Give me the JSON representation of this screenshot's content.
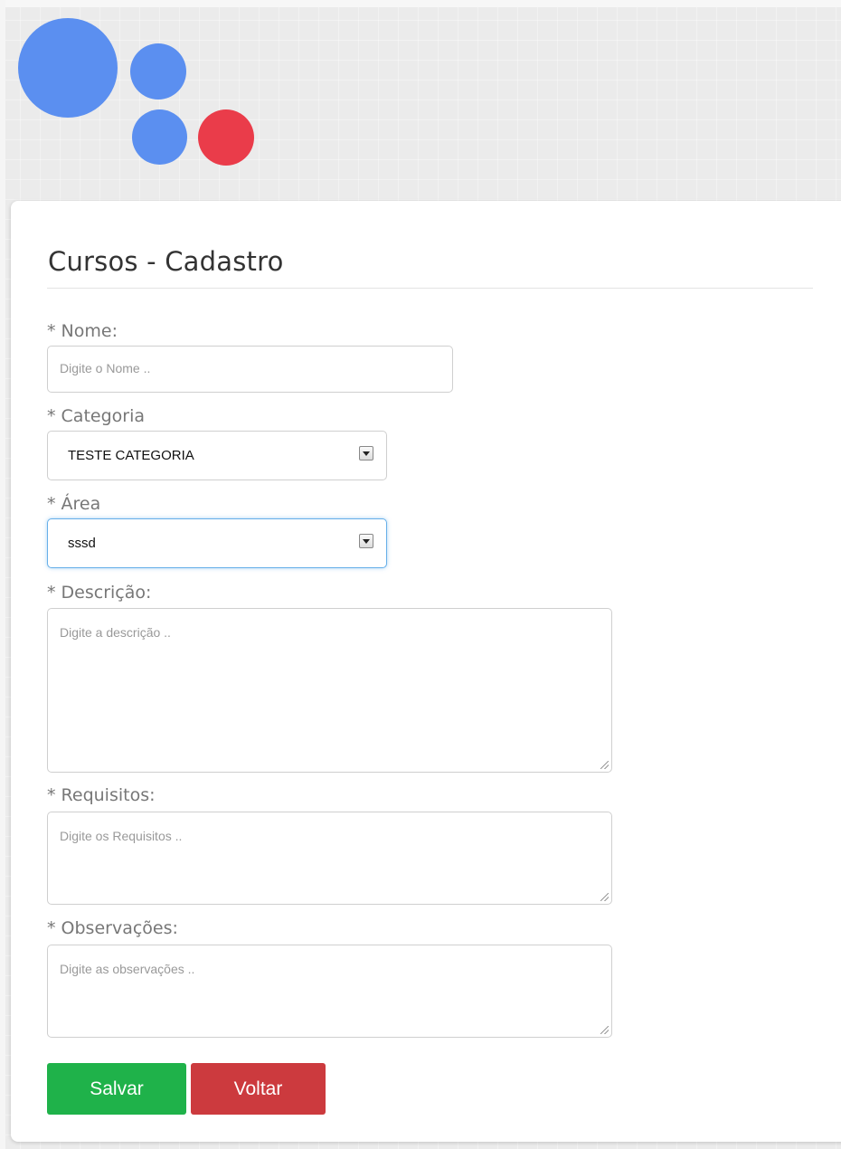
{
  "colors": {
    "logo_large_dot": "#5b8ff0",
    "logo_small_dot": "#5b8ff0",
    "logo_red_dot": "#ea3c4a",
    "save_button": "#1fb24a",
    "back_button": "#cc3a3e"
  },
  "form": {
    "title": "Cursos - Cadastro",
    "nome": {
      "label": "* Nome:",
      "placeholder": "Digite o Nome .."
    },
    "categoria": {
      "label": "* Categoria",
      "selected": "TESTE CATEGORIA"
    },
    "area": {
      "label": "* Área",
      "selected": "sssd"
    },
    "descricao": {
      "label": "* Descrição:",
      "placeholder": "Digite a descrição .."
    },
    "requisitos": {
      "label": "* Requisitos:",
      "placeholder": "Digite os Requisitos .."
    },
    "observacoes": {
      "label": "* Observações:",
      "placeholder": "Digite as observações .."
    }
  },
  "buttons": {
    "save": "Salvar",
    "back": "Voltar"
  }
}
